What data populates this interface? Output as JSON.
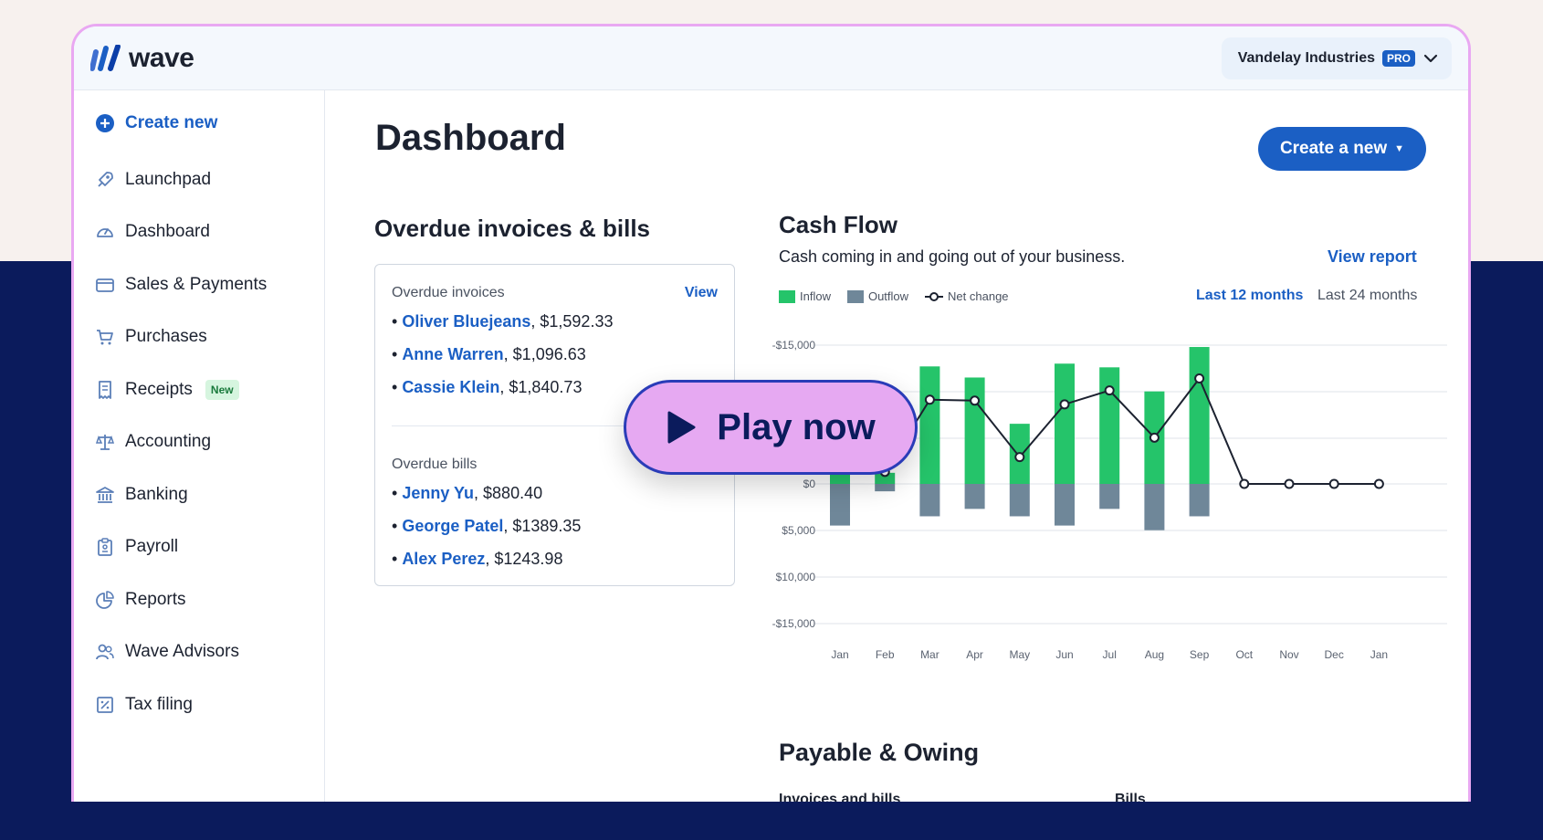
{
  "app": {
    "logo_text": "wave",
    "business_name": "Vandelay Industries",
    "plan_badge": "PRO"
  },
  "sidebar": {
    "items": [
      {
        "label": "Create new",
        "icon": "plus-circle-icon"
      },
      {
        "label": "Launchpad",
        "icon": "rocket-icon"
      },
      {
        "label": "Dashboard",
        "icon": "gauge-icon"
      },
      {
        "label": "Sales & Payments",
        "icon": "credit-card-icon"
      },
      {
        "label": "Purchases",
        "icon": "cart-icon"
      },
      {
        "label": "Receipts",
        "icon": "receipt-icon",
        "badge": "New"
      },
      {
        "label": "Accounting",
        "icon": "scale-icon"
      },
      {
        "label": "Banking",
        "icon": "bank-icon"
      },
      {
        "label": "Payroll",
        "icon": "clipboard-icon"
      },
      {
        "label": "Reports",
        "icon": "pie-chart-icon"
      },
      {
        "label": "Wave Advisors",
        "icon": "people-icon"
      },
      {
        "label": "Tax filing",
        "icon": "percent-icon"
      }
    ]
  },
  "main": {
    "title": "Dashboard",
    "create_button": "Create a new",
    "overdue": {
      "title": "Overdue invoices & bills",
      "invoices_label": "Overdue invoices",
      "view_label": "View",
      "invoices": [
        {
          "name": "Oliver Bluejeans",
          "amount": ", $1,592.33"
        },
        {
          "name": "Anne Warren",
          "amount": ", $1,096.63"
        },
        {
          "name": "Cassie Klein",
          "amount": ", $1,840.73"
        }
      ],
      "bills_label": "Overdue bills",
      "bills": [
        {
          "name": "Jenny Yu",
          "amount": ", $880.40"
        },
        {
          "name": "George Patel",
          "amount": ", $1389.35"
        },
        {
          "name": "Alex Perez",
          "amount": ", $1243.98"
        }
      ]
    },
    "cashflow": {
      "title": "Cash Flow",
      "subtitle": "Cash coming in and going out of your business.",
      "view_report": "View report",
      "legend": [
        "Inflow",
        "Outflow",
        "Net change"
      ],
      "range_active": "Last 12 months",
      "range_other": "Last 24 months"
    },
    "payable": {
      "title": "Payable & Owing",
      "col1_partial": "Invoices and bills",
      "col2_partial": "Bills"
    }
  },
  "overlay": {
    "play_label": "Play now"
  },
  "colors": {
    "accent": "#1b5fc4",
    "inflow": "#25c46a",
    "outflow": "#6f8799",
    "navy": "#0b1b5c",
    "play_bg": "#e6a9f2"
  },
  "chart_data": {
    "type": "bar",
    "categories": [
      "Jan",
      "Feb",
      "Mar",
      "Apr",
      "May",
      "Jun",
      "Jul",
      "Aug",
      "Sep",
      "Oct",
      "Nov",
      "Dec",
      "Jan"
    ],
    "y_tick_labels": [
      "-$15,000",
      "$0",
      "$5,000",
      "$10,000",
      "-$15,000"
    ],
    "ylim": [
      -15000,
      15000
    ],
    "series": [
      {
        "name": "Inflow",
        "values": [
          1500,
          1200,
          12700,
          11500,
          6500,
          13000,
          12600,
          10000,
          14800,
          0,
          0,
          0,
          0
        ]
      },
      {
        "name": "Outflow",
        "values": [
          -4500,
          -800,
          -3500,
          -2700,
          -3500,
          -4500,
          -2700,
          -5000,
          -3500,
          0,
          0,
          0,
          0
        ]
      },
      {
        "name": "Net change",
        "values": [
          5000,
          1300,
          9100,
          9000,
          2900,
          8600,
          10100,
          5000,
          11400,
          0,
          0,
          0,
          0
        ]
      }
    ],
    "grid": true,
    "legend": "top-left"
  }
}
